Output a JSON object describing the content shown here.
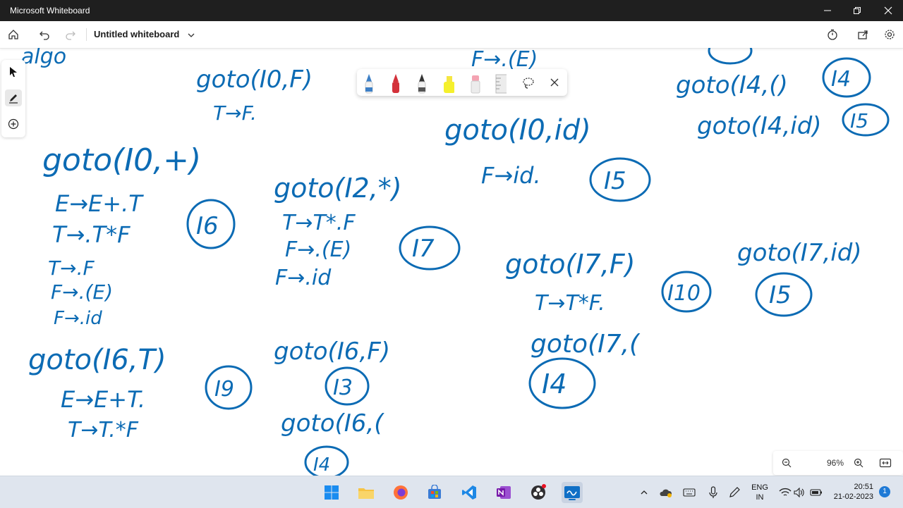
{
  "app": {
    "window_title": "Microsoft Whiteboard"
  },
  "toolbar": {
    "doc_title": "Untitled whiteboard"
  },
  "colors": {
    "ink": "#0c6bb4",
    "titlebar": "#1f1f1f",
    "taskbar": "#dfe5ee"
  },
  "canvas": {
    "ink_items": [
      "goto(I0,F)",
      "T→F.",
      "F→.(E)",
      "goto(I0,id)",
      "F→id.",
      "I5",
      "goto(I4,()",
      "I4",
      "goto(I4,id)",
      "I5",
      "goto(I0,+)",
      "E→E+.T",
      "T→.T*F",
      "I6",
      "T→.F",
      "F→.(E)",
      "F→.id",
      "goto(I2,*)",
      "T→T*.F",
      "F→.(E)",
      "F→.id",
      "I7",
      "goto(I7,F)",
      "T→T*F.",
      "I10",
      "goto(I7,id)",
      "I5",
      "goto(I7,(",
      "I4",
      "goto(I6,T)",
      "E→E+T.",
      "T→T.*F",
      "I9",
      "goto(I6,F)",
      "I3",
      "goto(I6,(",
      "I4",
      "algo"
    ]
  },
  "zoom": {
    "level": "96%"
  },
  "taskbar": {
    "lang_top": "ENG",
    "lang_bottom": "IN",
    "time": "20:51",
    "date": "21-02-2023",
    "notification_count": "1"
  }
}
